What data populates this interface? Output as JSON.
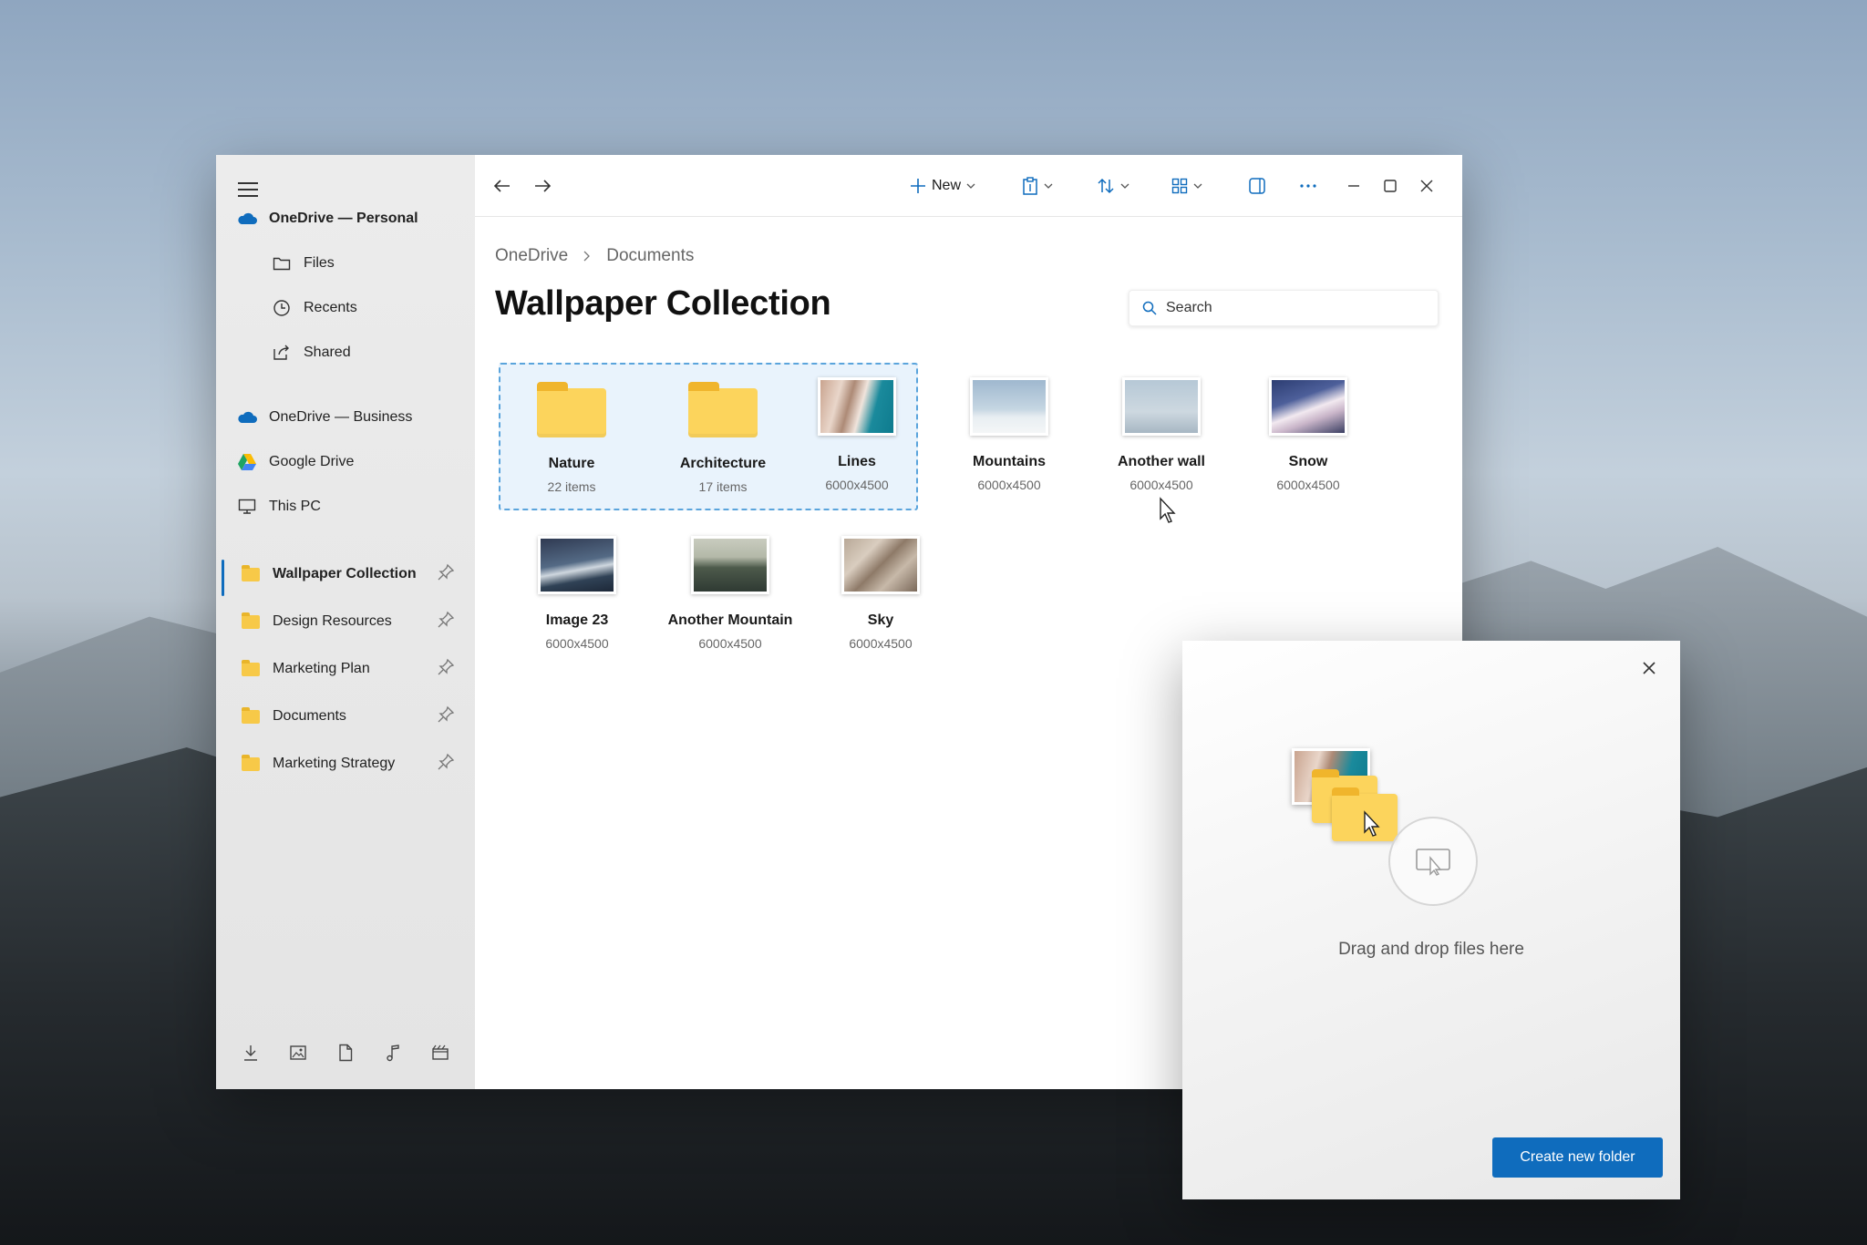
{
  "sidebar": {
    "accounts": [
      {
        "label": "OneDrive — Personal",
        "icon": "cloud-icon"
      },
      {
        "label": "OneDrive — Business",
        "icon": "cloud-icon"
      },
      {
        "label": "Google Drive",
        "icon": "google-drive-icon"
      },
      {
        "label": "This PC",
        "icon": "monitor-icon"
      }
    ],
    "personal_items": [
      {
        "label": "Files",
        "icon": "folder-outline-icon"
      },
      {
        "label": "Recents",
        "icon": "clock-icon"
      },
      {
        "label": "Shared",
        "icon": "share-icon"
      }
    ],
    "pinned": [
      {
        "label": "Wallpaper Collection",
        "active": true
      },
      {
        "label": "Design Resources"
      },
      {
        "label": "Marketing Plan"
      },
      {
        "label": "Documents"
      },
      {
        "label": "Marketing Strategy"
      }
    ],
    "bottom_icons": [
      "download-icon",
      "image-icon",
      "document-icon",
      "music-icon",
      "video-icon"
    ]
  },
  "toolbar": {
    "new_label": "New"
  },
  "breadcrumb": [
    "OneDrive",
    "Documents"
  ],
  "page_title": "Wallpaper Collection",
  "search": {
    "placeholder": "Search"
  },
  "items": [
    {
      "name": "Nature",
      "meta": "22 items",
      "kind": "folder"
    },
    {
      "name": "Architecture",
      "meta": "17 items",
      "kind": "folder"
    },
    {
      "name": "Lines",
      "meta": "6000x4500",
      "kind": "image"
    },
    {
      "name": "Mountains",
      "meta": "6000x4500",
      "kind": "image"
    },
    {
      "name": "Another wall",
      "meta": "6000x4500",
      "kind": "image"
    },
    {
      "name": "Snow",
      "meta": "6000x4500",
      "kind": "image"
    },
    {
      "name": "Image 23",
      "meta": "6000x4500",
      "kind": "image"
    },
    {
      "name": "Another Mountain",
      "meta": "6000x4500",
      "kind": "image"
    },
    {
      "name": "Sky",
      "meta": "6000x4500",
      "kind": "image"
    }
  ],
  "drop_panel": {
    "text": "Drag and drop files here",
    "button_label": "Create new folder"
  },
  "colors": {
    "accent": "#0f6cbd",
    "folder": "#fcd45c",
    "selection": "#5aa4dc"
  }
}
